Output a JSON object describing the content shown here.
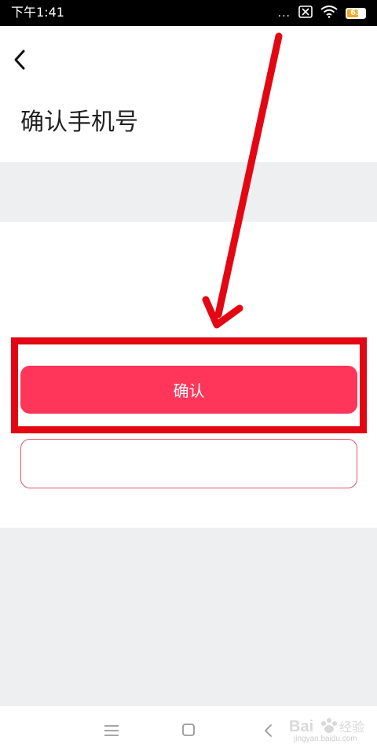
{
  "status_bar": {
    "time": "下午1:41",
    "dots": "...",
    "battery_level": "63"
  },
  "header": {
    "title": "确认手机号"
  },
  "main": {
    "confirm_label": "确认",
    "secondary_label": ""
  },
  "watermark": {
    "logo": "Bai 经验",
    "url": "jingyan.baidu.com"
  },
  "colors": {
    "accent": "#ff3659",
    "annotation": "#e30613",
    "band": "#eeeff1"
  },
  "icons": {
    "back": "chevron-left-icon",
    "nav_menu": "menu-icon",
    "nav_home": "square-icon",
    "nav_back": "back-triangle-icon"
  }
}
